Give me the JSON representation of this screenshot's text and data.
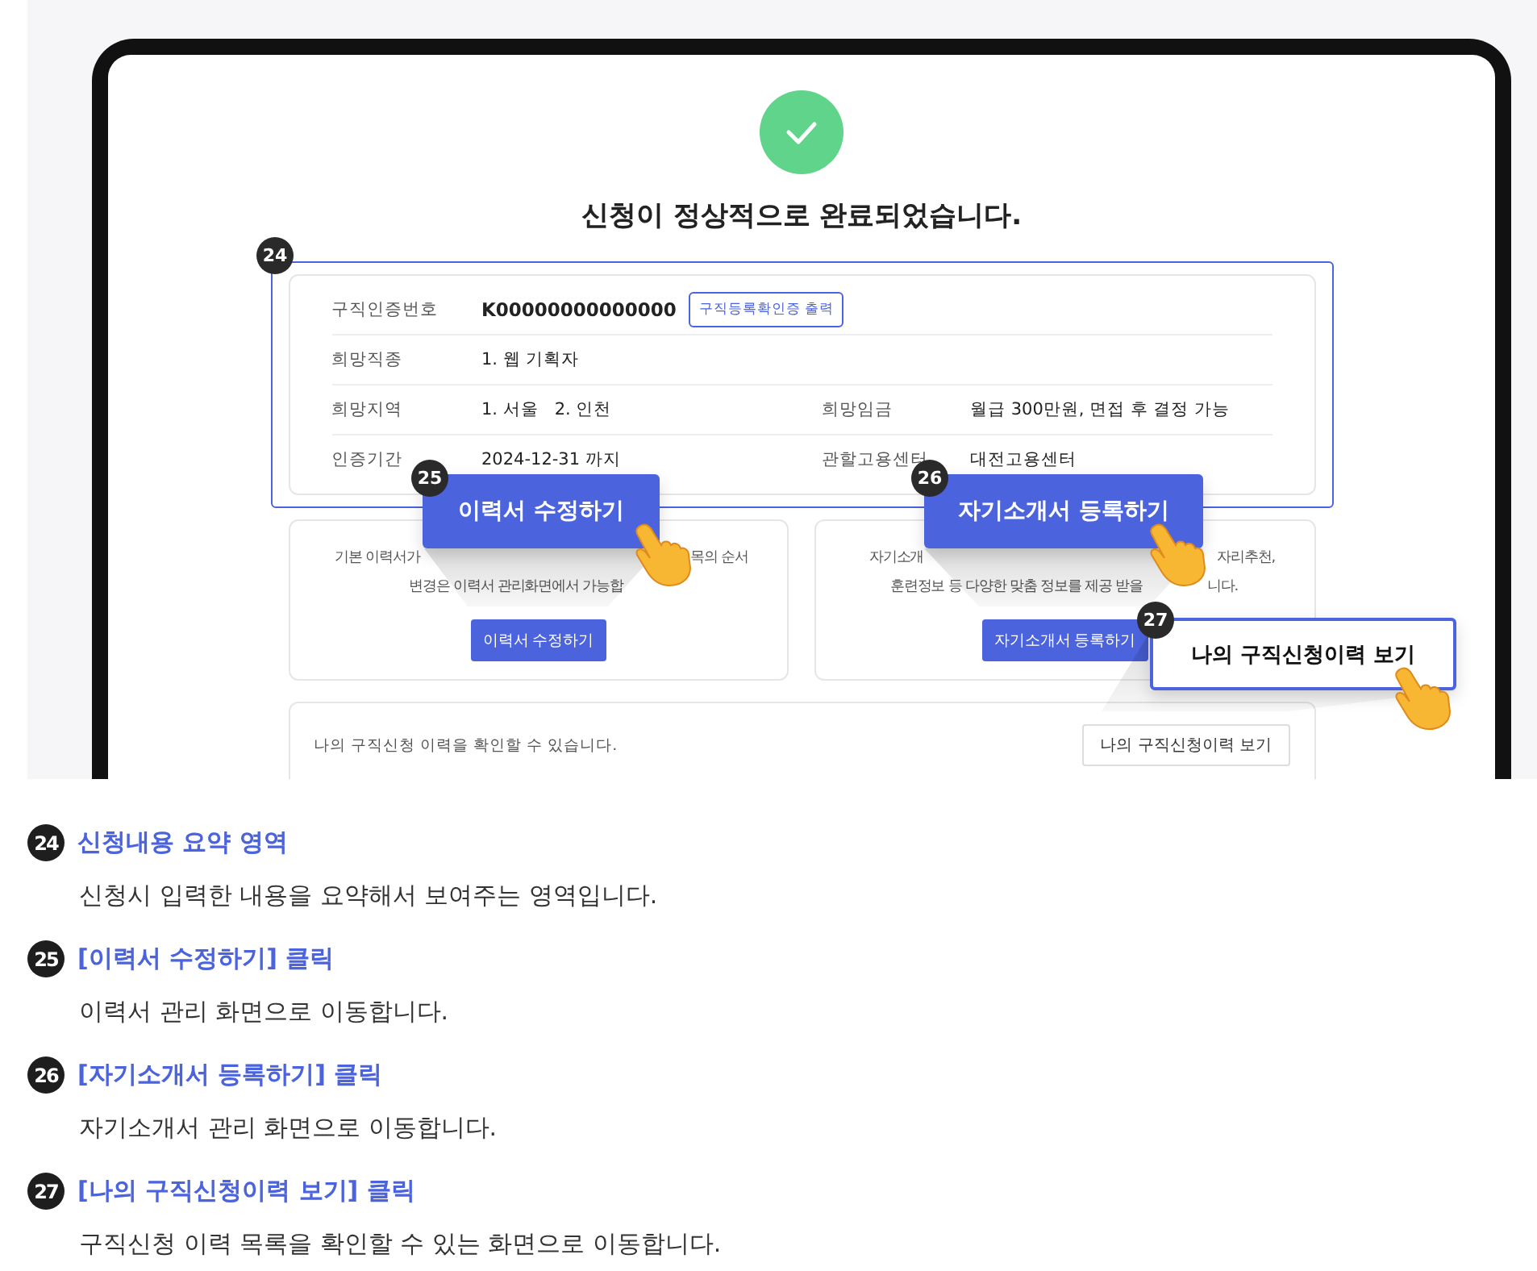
{
  "screen": {
    "status_title": "신청이 정상적으로 완료되었습니다.",
    "summary": {
      "marker": "24",
      "rows": [
        {
          "fields": [
            {
              "label": "구직인증번호",
              "value": "K00000000000000",
              "strong": true,
              "action": "구직등록확인증 출력"
            }
          ]
        },
        {
          "fields": [
            {
              "label": "희망직종",
              "value": "1. 웹 기획자"
            }
          ]
        },
        {
          "fields": [
            {
              "label": "희망지역",
              "value": "1. 서울   2. 인천"
            },
            {
              "label": "희망임금",
              "value": "월급 300만원, 면접 후 결정 가능"
            }
          ]
        },
        {
          "fields": [
            {
              "label": "인증기간",
              "value": "2024-12-31 까지"
            },
            {
              "label": "관할고용센터",
              "value": "대전고용센터"
            }
          ]
        }
      ]
    },
    "cards": [
      {
        "lines": [
          [
            "기본 이력서가",
            "목의 순서"
          ],
          [
            "변경은 이력서 관리화면에서 가능합"
          ]
        ],
        "button": "이력서 수정하기"
      },
      {
        "lines": [
          [
            "자기소개",
            "자리추천,"
          ],
          [
            "훈련정보 등 다양한 맞춤 정보를 제공 받을",
            "니다."
          ]
        ],
        "button": "자기소개서 등록하기"
      }
    ],
    "history": {
      "text": "나의 구직신청 이력을 확인할 수 있습니다.",
      "button": "나의 구직신청이력 보기"
    }
  },
  "callouts": [
    {
      "number": "25",
      "label": "이력서 수정하기",
      "kind": "filled"
    },
    {
      "number": "26",
      "label": "자기소개서 등록하기",
      "kind": "filled"
    },
    {
      "number": "27",
      "label": "나의 구직신청이력 보기",
      "kind": "outlined"
    }
  ],
  "legend": [
    {
      "number": "24",
      "title": "신청내용 요약 영역",
      "description": "신청시 입력한 내용을 요약해서 보여주는 영역입니다."
    },
    {
      "number": "25",
      "title": "[이력서 수정하기] 클릭",
      "description": "이력서 관리 화면으로 이동합니다."
    },
    {
      "number": "26",
      "title": "[자기소개서 등록하기] 클릭",
      "description": "자기소개서 관리 화면으로 이동합니다."
    },
    {
      "number": "27",
      "title": "[나의 구직신청이력 보기] 클릭",
      "description": "구직신청 이력 목록을 확인할 수 있는 화면으로 이동합니다."
    }
  ]
}
